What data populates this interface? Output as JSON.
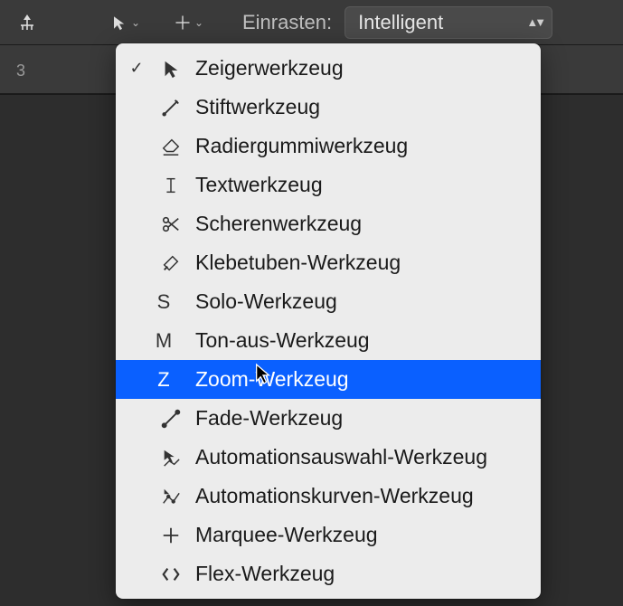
{
  "toolbar": {
    "snap_label": "Einrasten:",
    "snap_value": "Intelligent"
  },
  "ruler": {
    "marker": "3"
  },
  "menu": {
    "items": [
      {
        "label": "Zeigerwerkzeug",
        "key": "",
        "icon": "pointer",
        "checked": true,
        "selected": false
      },
      {
        "label": "Stiftwerkzeug",
        "key": "",
        "icon": "pencil",
        "checked": false,
        "selected": false
      },
      {
        "label": "Radiergummiwerkzeug",
        "key": "",
        "icon": "eraser",
        "checked": false,
        "selected": false
      },
      {
        "label": "Textwerkzeug",
        "key": "",
        "icon": "text",
        "checked": false,
        "selected": false
      },
      {
        "label": "Scherenwerkzeug",
        "key": "",
        "icon": "scissors",
        "checked": false,
        "selected": false
      },
      {
        "label": "Klebetuben-Werkzeug",
        "key": "",
        "icon": "glue",
        "checked": false,
        "selected": false
      },
      {
        "label": "Solo-Werkzeug",
        "key": "S",
        "icon": "",
        "checked": false,
        "selected": false
      },
      {
        "label": "Ton-aus-Werkzeug",
        "key": "M",
        "icon": "",
        "checked": false,
        "selected": false
      },
      {
        "label": "Zoom-Werkzeug",
        "key": "Z",
        "icon": "",
        "checked": false,
        "selected": true
      },
      {
        "label": "Fade-Werkzeug",
        "key": "",
        "icon": "fade",
        "checked": false,
        "selected": false
      },
      {
        "label": "Automationsauswahl-Werkzeug",
        "key": "",
        "icon": "autosel",
        "checked": false,
        "selected": false
      },
      {
        "label": "Automationskurven-Werkzeug",
        "key": "",
        "icon": "autocurve",
        "checked": false,
        "selected": false
      },
      {
        "label": "Marquee-Werkzeug",
        "key": "",
        "icon": "marquee",
        "checked": false,
        "selected": false
      },
      {
        "label": "Flex-Werkzeug",
        "key": "",
        "icon": "flex",
        "checked": false,
        "selected": false
      }
    ]
  }
}
